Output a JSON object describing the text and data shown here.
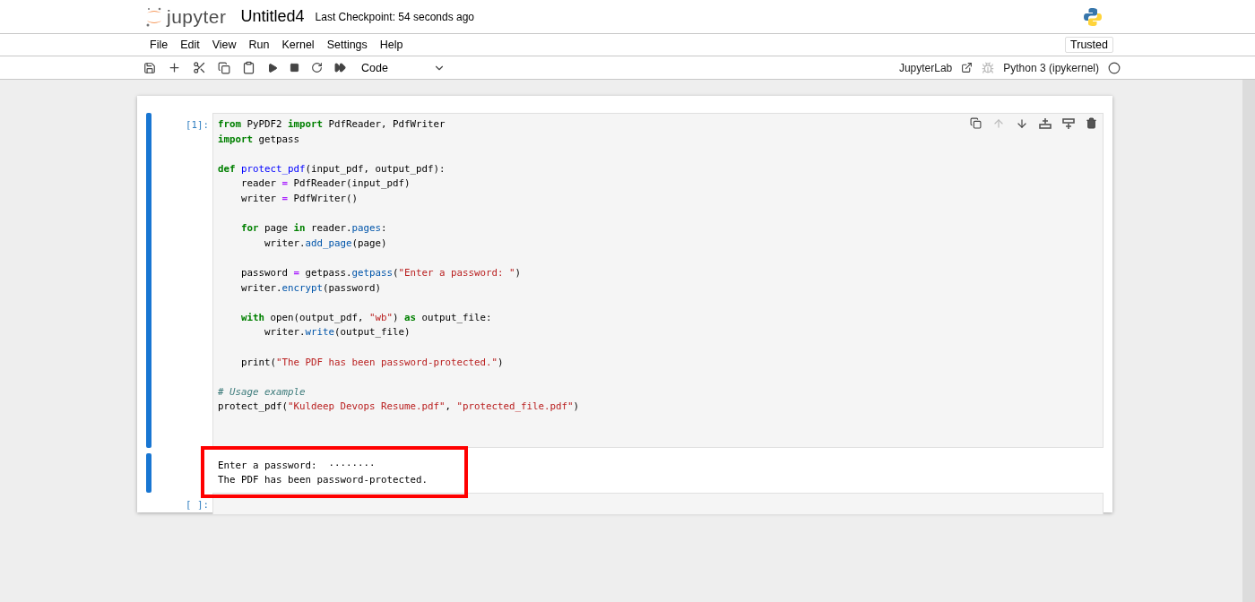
{
  "header": {
    "logo_text": "jupyter",
    "title": "Untitled4",
    "checkpoint": "Last Checkpoint: 54 seconds ago"
  },
  "menu": [
    "File",
    "Edit",
    "View",
    "Run",
    "Kernel",
    "Settings",
    "Help"
  ],
  "trusted": "Trusted",
  "toolbar": {
    "cell_type": "Code",
    "open_in": "JupyterLab",
    "kernel": "Python 3 (ipykernel)",
    "kernel_busy": false
  },
  "cells": [
    {
      "prompt": "[1]:",
      "selected": true,
      "blocks": [
        [
          [
            {
              "kind": "kw",
              "text": "from"
            },
            {
              "kind": "plain",
              "text": " PyPDF2 "
            },
            {
              "kind": "kw",
              "text": "import"
            },
            {
              "kind": "plain",
              "text": " PdfReader, PdfWriter"
            }
          ],
          [
            {
              "kind": "kw",
              "text": "import"
            },
            {
              "kind": "plain",
              "text": " getpass"
            }
          ]
        ],
        [
          [
            {
              "kind": "kw",
              "text": "def"
            },
            {
              "kind": "fn",
              "text": " protect_pdf"
            },
            {
              "kind": "plain",
              "text": "(input_pdf, output_pdf):"
            }
          ],
          [
            {
              "kind": "plain",
              "text": "    reader "
            },
            {
              "kind": "op",
              "text": "="
            },
            {
              "kind": "plain",
              "text": " PdfReader(input_pdf)"
            }
          ],
          [
            {
              "kind": "plain",
              "text": "    writer "
            },
            {
              "kind": "op",
              "text": "="
            },
            {
              "kind": "plain",
              "text": " PdfWriter()"
            }
          ]
        ],
        [
          [
            {
              "kind": "kw",
              "text": "    for"
            },
            {
              "kind": "plain",
              "text": " page "
            },
            {
              "kind": "kw",
              "text": "in"
            },
            {
              "kind": "plain",
              "text": " reader."
            },
            {
              "kind": "attr",
              "text": "pages"
            },
            {
              "kind": "plain",
              "text": ":"
            }
          ],
          [
            {
              "kind": "plain",
              "text": "        writer."
            },
            {
              "kind": "attr",
              "text": "add_page"
            },
            {
              "kind": "plain",
              "text": "(page)"
            }
          ]
        ],
        [
          [
            {
              "kind": "plain",
              "text": "    password "
            },
            {
              "kind": "op",
              "text": "="
            },
            {
              "kind": "plain",
              "text": " getpass."
            },
            {
              "kind": "attr",
              "text": "getpass"
            },
            {
              "kind": "plain",
              "text": "("
            },
            {
              "kind": "str",
              "text": "\"Enter a password: \""
            },
            {
              "kind": "plain",
              "text": ")"
            }
          ],
          [
            {
              "kind": "plain",
              "text": "    writer."
            },
            {
              "kind": "attr",
              "text": "encrypt"
            },
            {
              "kind": "plain",
              "text": "(password)"
            }
          ]
        ],
        [
          [
            {
              "kind": "kw",
              "text": "    with"
            },
            {
              "kind": "plain",
              "text": " open(output_pdf, "
            },
            {
              "kind": "str",
              "text": "\"wb\""
            },
            {
              "kind": "plain",
              "text": ") "
            },
            {
              "kind": "kw",
              "text": "as"
            },
            {
              "kind": "plain",
              "text": " output_file:"
            }
          ],
          [
            {
              "kind": "plain",
              "text": "        writer."
            },
            {
              "kind": "attr",
              "text": "write"
            },
            {
              "kind": "plain",
              "text": "(output_file)"
            }
          ]
        ],
        [
          [
            {
              "kind": "plain",
              "text": "    print("
            },
            {
              "kind": "str",
              "text": "\"The PDF has been password-protected.\""
            },
            {
              "kind": "plain",
              "text": ")"
            }
          ]
        ],
        [
          [
            {
              "kind": "comment",
              "text": "# Usage example"
            }
          ],
          [
            {
              "kind": "plain",
              "text": "protect_pdf("
            },
            {
              "kind": "str",
              "text": "\"Kuldeep Devops Resume.pdf\""
            },
            {
              "kind": "plain",
              "text": ", "
            },
            {
              "kind": "str",
              "text": "\"protected_file.pdf\""
            },
            {
              "kind": "plain",
              "text": ")"
            }
          ]
        ]
      ],
      "output": [
        "Enter a password:  ········",
        "The PDF has been password-protected."
      ],
      "output_highlighted": true
    },
    {
      "prompt": "[ ]:",
      "selected": false
    }
  ]
}
